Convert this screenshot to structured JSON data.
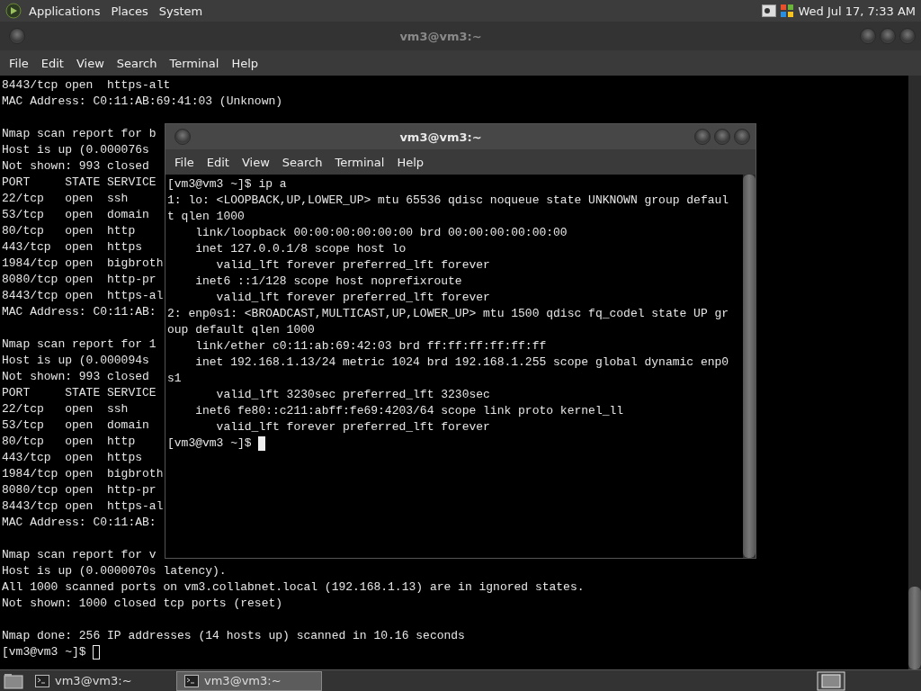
{
  "top_panel": {
    "menus": [
      "Applications",
      "Places",
      "System"
    ],
    "clock": "Wed Jul 17, 7:33 AM"
  },
  "back_window": {
    "title": "vm3@vm3:~",
    "menu": [
      "File",
      "Edit",
      "View",
      "Search",
      "Terminal",
      "Help"
    ],
    "blocks": [
      [
        "8443/tcp open  https-alt",
        "MAC Address: C0:11:AB:69:41:03 (Unknown)"
      ],
      [
        "Nmap scan report for b",
        "Host is up (0.000076s",
        "Not shown: 993 closed",
        "PORT     STATE SERVICE",
        "22/tcp   open  ssh",
        "53/tcp   open  domain",
        "80/tcp   open  http",
        "443/tcp  open  https",
        "1984/tcp open  bigbroth",
        "8080/tcp open  http-pr",
        "8443/tcp open  https-al",
        "MAC Address: C0:11:AB:"
      ],
      [
        "Nmap scan report for 1",
        "Host is up (0.000094s",
        "Not shown: 993 closed",
        "PORT     STATE SERVICE",
        "22/tcp   open  ssh",
        "53/tcp   open  domain",
        "80/tcp   open  http",
        "443/tcp  open  https",
        "1984/tcp open  bigbroth",
        "8080/tcp open  http-pr",
        "8443/tcp open  https-al",
        "MAC Address: C0:11:AB:"
      ],
      [
        "Nmap scan report for v",
        "Host is up (0.0000070s latency).",
        "All 1000 scanned ports on vm3.collabnet.local (192.168.1.13) are in ignored states.",
        "Not shown: 1000 closed tcp ports (reset)"
      ],
      [
        "Nmap done: 256 IP addresses (14 hosts up) scanned in 10.16 seconds"
      ]
    ],
    "prompt": "[vm3@vm3 ~]$ "
  },
  "front_window": {
    "title": "vm3@vm3:~",
    "menu": [
      "File",
      "Edit",
      "View",
      "Search",
      "Terminal",
      "Help"
    ],
    "lines": [
      "[vm3@vm3 ~]$ ip a",
      "1: lo: <LOOPBACK,UP,LOWER_UP> mtu 65536 qdisc noqueue state UNKNOWN group defaul",
      "t qlen 1000",
      "    link/loopback 00:00:00:00:00:00 brd 00:00:00:00:00:00",
      "    inet 127.0.0.1/8 scope host lo",
      "       valid_lft forever preferred_lft forever",
      "    inet6 ::1/128 scope host noprefixroute",
      "       valid_lft forever preferred_lft forever",
      "2: enp0s1: <BROADCAST,MULTICAST,UP,LOWER_UP> mtu 1500 qdisc fq_codel state UP gr",
      "oup default qlen 1000",
      "    link/ether c0:11:ab:69:42:03 brd ff:ff:ff:ff:ff:ff",
      "    inet 192.168.1.13/24 metric 1024 brd 192.168.1.255 scope global dynamic enp0",
      "s1",
      "       valid_lft 3230sec preferred_lft 3230sec",
      "    inet6 fe80::c211:abff:fe69:4203/64 scope link proto kernel_ll",
      "       valid_lft forever preferred_lft forever"
    ],
    "prompt": "[vm3@vm3 ~]$ "
  },
  "taskbar": {
    "tasks": [
      {
        "label": "vm3@vm3:~",
        "selected": false
      },
      {
        "label": "vm3@vm3:~",
        "selected": true
      }
    ]
  }
}
